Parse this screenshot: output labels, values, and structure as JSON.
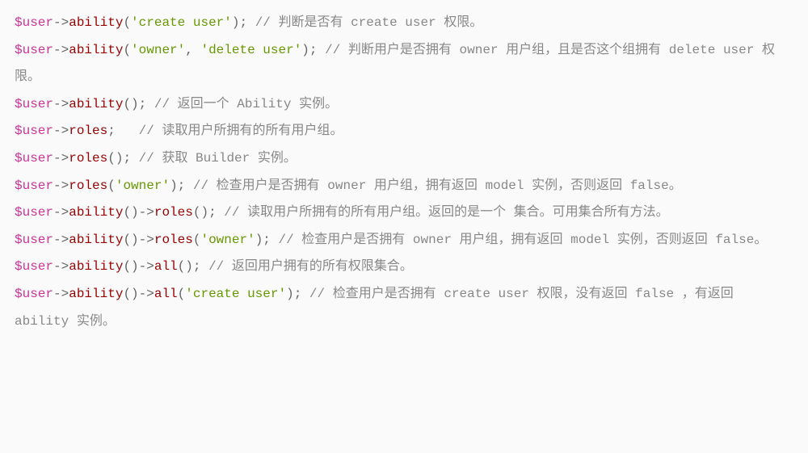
{
  "lines": [
    [
      {
        "cls": "var",
        "t": "$user"
      },
      {
        "cls": "arrow",
        "t": "->"
      },
      {
        "cls": "func",
        "t": "ability"
      },
      {
        "cls": "punct",
        "t": "("
      },
      {
        "cls": "str",
        "t": "'create user'"
      },
      {
        "cls": "punct",
        "t": "); "
      },
      {
        "cls": "com",
        "t": "// 判断是否有 create user 权限。"
      }
    ],
    [
      {
        "cls": "var",
        "t": "$user"
      },
      {
        "cls": "arrow",
        "t": "->"
      },
      {
        "cls": "func",
        "t": "ability"
      },
      {
        "cls": "punct",
        "t": "("
      },
      {
        "cls": "str",
        "t": "'owner'"
      },
      {
        "cls": "punct",
        "t": ", "
      },
      {
        "cls": "str",
        "t": "'delete user'"
      },
      {
        "cls": "punct",
        "t": "); "
      },
      {
        "cls": "com",
        "t": "// 判断用户是否拥有 owner 用户组，且是否这个组拥有 delete user 权限。"
      }
    ],
    [
      {
        "cls": "var",
        "t": "$user"
      },
      {
        "cls": "arrow",
        "t": "->"
      },
      {
        "cls": "func",
        "t": "ability"
      },
      {
        "cls": "punct",
        "t": "(); "
      },
      {
        "cls": "com",
        "t": "// 返回一个 Ability 实例。"
      }
    ],
    [
      {
        "cls": "var",
        "t": "$user"
      },
      {
        "cls": "arrow",
        "t": "->"
      },
      {
        "cls": "func",
        "t": "roles"
      },
      {
        "cls": "punct",
        "t": ";   "
      },
      {
        "cls": "com",
        "t": "// 读取用户所拥有的所有用户组。"
      }
    ],
    [
      {
        "cls": "var",
        "t": "$user"
      },
      {
        "cls": "arrow",
        "t": "->"
      },
      {
        "cls": "func",
        "t": "roles"
      },
      {
        "cls": "punct",
        "t": "(); "
      },
      {
        "cls": "com",
        "t": "// 获取 Builder 实例。"
      }
    ],
    [
      {
        "cls": "var",
        "t": "$user"
      },
      {
        "cls": "arrow",
        "t": "->"
      },
      {
        "cls": "func",
        "t": "roles"
      },
      {
        "cls": "punct",
        "t": "("
      },
      {
        "cls": "str",
        "t": "'owner'"
      },
      {
        "cls": "punct",
        "t": "); "
      },
      {
        "cls": "com",
        "t": "// 检查用户是否拥有 owner 用户组，拥有返回 model 实例，否则返回 false。"
      }
    ],
    [
      {
        "cls": "var",
        "t": "$user"
      },
      {
        "cls": "arrow",
        "t": "->"
      },
      {
        "cls": "func",
        "t": "ability"
      },
      {
        "cls": "punct",
        "t": "()"
      },
      {
        "cls": "arrow",
        "t": "->"
      },
      {
        "cls": "func",
        "t": "roles"
      },
      {
        "cls": "punct",
        "t": "(); "
      },
      {
        "cls": "com",
        "t": "// 读取用户所拥有的所有用户组。返回的是一个 集合。可用集合所有方法。"
      }
    ],
    [
      {
        "cls": "var",
        "t": "$user"
      },
      {
        "cls": "arrow",
        "t": "->"
      },
      {
        "cls": "func",
        "t": "ability"
      },
      {
        "cls": "punct",
        "t": "()"
      },
      {
        "cls": "arrow",
        "t": "->"
      },
      {
        "cls": "func",
        "t": "roles"
      },
      {
        "cls": "punct",
        "t": "("
      },
      {
        "cls": "str",
        "t": "'owner'"
      },
      {
        "cls": "punct",
        "t": "); "
      },
      {
        "cls": "com",
        "t": "// 检查用户是否拥有 owner 用户组，拥有返回 model 实例，否则返回 false。"
      }
    ],
    [
      {
        "cls": "var",
        "t": "$user"
      },
      {
        "cls": "arrow",
        "t": "->"
      },
      {
        "cls": "func",
        "t": "ability"
      },
      {
        "cls": "punct",
        "t": "()"
      },
      {
        "cls": "arrow",
        "t": "->"
      },
      {
        "cls": "func",
        "t": "all"
      },
      {
        "cls": "punct",
        "t": "(); "
      },
      {
        "cls": "com",
        "t": "// 返回用户拥有的所有权限集合。"
      }
    ],
    [
      {
        "cls": "var",
        "t": "$user"
      },
      {
        "cls": "arrow",
        "t": "->"
      },
      {
        "cls": "func",
        "t": "ability"
      },
      {
        "cls": "punct",
        "t": "()"
      },
      {
        "cls": "arrow",
        "t": "->"
      },
      {
        "cls": "func",
        "t": "all"
      },
      {
        "cls": "punct",
        "t": "("
      },
      {
        "cls": "str",
        "t": "'create user'"
      },
      {
        "cls": "punct",
        "t": "); "
      },
      {
        "cls": "com",
        "t": "// 检查用户是否拥有 create user 权限，没有返回 false ，有返回 ability 实例。"
      }
    ]
  ]
}
